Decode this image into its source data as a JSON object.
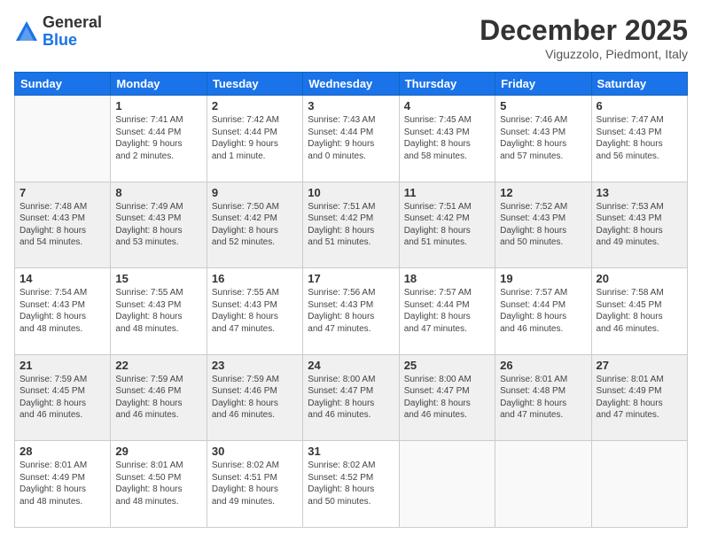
{
  "logo": {
    "general": "General",
    "blue": "Blue"
  },
  "header": {
    "month": "December 2025",
    "location": "Viguzzolo, Piedmont, Italy"
  },
  "weekdays": [
    "Sunday",
    "Monday",
    "Tuesday",
    "Wednesday",
    "Thursday",
    "Friday",
    "Saturday"
  ],
  "weeks": [
    [
      {
        "day": "",
        "info": ""
      },
      {
        "day": "1",
        "info": "Sunrise: 7:41 AM\nSunset: 4:44 PM\nDaylight: 9 hours\nand 2 minutes."
      },
      {
        "day": "2",
        "info": "Sunrise: 7:42 AM\nSunset: 4:44 PM\nDaylight: 9 hours\nand 1 minute."
      },
      {
        "day": "3",
        "info": "Sunrise: 7:43 AM\nSunset: 4:44 PM\nDaylight: 9 hours\nand 0 minutes."
      },
      {
        "day": "4",
        "info": "Sunrise: 7:45 AM\nSunset: 4:43 PM\nDaylight: 8 hours\nand 58 minutes."
      },
      {
        "day": "5",
        "info": "Sunrise: 7:46 AM\nSunset: 4:43 PM\nDaylight: 8 hours\nand 57 minutes."
      },
      {
        "day": "6",
        "info": "Sunrise: 7:47 AM\nSunset: 4:43 PM\nDaylight: 8 hours\nand 56 minutes."
      }
    ],
    [
      {
        "day": "7",
        "info": "Sunrise: 7:48 AM\nSunset: 4:43 PM\nDaylight: 8 hours\nand 54 minutes."
      },
      {
        "day": "8",
        "info": "Sunrise: 7:49 AM\nSunset: 4:43 PM\nDaylight: 8 hours\nand 53 minutes."
      },
      {
        "day": "9",
        "info": "Sunrise: 7:50 AM\nSunset: 4:42 PM\nDaylight: 8 hours\nand 52 minutes."
      },
      {
        "day": "10",
        "info": "Sunrise: 7:51 AM\nSunset: 4:42 PM\nDaylight: 8 hours\nand 51 minutes."
      },
      {
        "day": "11",
        "info": "Sunrise: 7:51 AM\nSunset: 4:42 PM\nDaylight: 8 hours\nand 51 minutes."
      },
      {
        "day": "12",
        "info": "Sunrise: 7:52 AM\nSunset: 4:43 PM\nDaylight: 8 hours\nand 50 minutes."
      },
      {
        "day": "13",
        "info": "Sunrise: 7:53 AM\nSunset: 4:43 PM\nDaylight: 8 hours\nand 49 minutes."
      }
    ],
    [
      {
        "day": "14",
        "info": "Sunrise: 7:54 AM\nSunset: 4:43 PM\nDaylight: 8 hours\nand 48 minutes."
      },
      {
        "day": "15",
        "info": "Sunrise: 7:55 AM\nSunset: 4:43 PM\nDaylight: 8 hours\nand 48 minutes."
      },
      {
        "day": "16",
        "info": "Sunrise: 7:55 AM\nSunset: 4:43 PM\nDaylight: 8 hours\nand 47 minutes."
      },
      {
        "day": "17",
        "info": "Sunrise: 7:56 AM\nSunset: 4:43 PM\nDaylight: 8 hours\nand 47 minutes."
      },
      {
        "day": "18",
        "info": "Sunrise: 7:57 AM\nSunset: 4:44 PM\nDaylight: 8 hours\nand 47 minutes."
      },
      {
        "day": "19",
        "info": "Sunrise: 7:57 AM\nSunset: 4:44 PM\nDaylight: 8 hours\nand 46 minutes."
      },
      {
        "day": "20",
        "info": "Sunrise: 7:58 AM\nSunset: 4:45 PM\nDaylight: 8 hours\nand 46 minutes."
      }
    ],
    [
      {
        "day": "21",
        "info": "Sunrise: 7:59 AM\nSunset: 4:45 PM\nDaylight: 8 hours\nand 46 minutes."
      },
      {
        "day": "22",
        "info": "Sunrise: 7:59 AM\nSunset: 4:46 PM\nDaylight: 8 hours\nand 46 minutes."
      },
      {
        "day": "23",
        "info": "Sunrise: 7:59 AM\nSunset: 4:46 PM\nDaylight: 8 hours\nand 46 minutes."
      },
      {
        "day": "24",
        "info": "Sunrise: 8:00 AM\nSunset: 4:47 PM\nDaylight: 8 hours\nand 46 minutes."
      },
      {
        "day": "25",
        "info": "Sunrise: 8:00 AM\nSunset: 4:47 PM\nDaylight: 8 hours\nand 46 minutes."
      },
      {
        "day": "26",
        "info": "Sunrise: 8:01 AM\nSunset: 4:48 PM\nDaylight: 8 hours\nand 47 minutes."
      },
      {
        "day": "27",
        "info": "Sunrise: 8:01 AM\nSunset: 4:49 PM\nDaylight: 8 hours\nand 47 minutes."
      }
    ],
    [
      {
        "day": "28",
        "info": "Sunrise: 8:01 AM\nSunset: 4:49 PM\nDaylight: 8 hours\nand 48 minutes."
      },
      {
        "day": "29",
        "info": "Sunrise: 8:01 AM\nSunset: 4:50 PM\nDaylight: 8 hours\nand 48 minutes."
      },
      {
        "day": "30",
        "info": "Sunrise: 8:02 AM\nSunset: 4:51 PM\nDaylight: 8 hours\nand 49 minutes."
      },
      {
        "day": "31",
        "info": "Sunrise: 8:02 AM\nSunset: 4:52 PM\nDaylight: 8 hours\nand 50 minutes."
      },
      {
        "day": "",
        "info": ""
      },
      {
        "day": "",
        "info": ""
      },
      {
        "day": "",
        "info": ""
      }
    ]
  ]
}
